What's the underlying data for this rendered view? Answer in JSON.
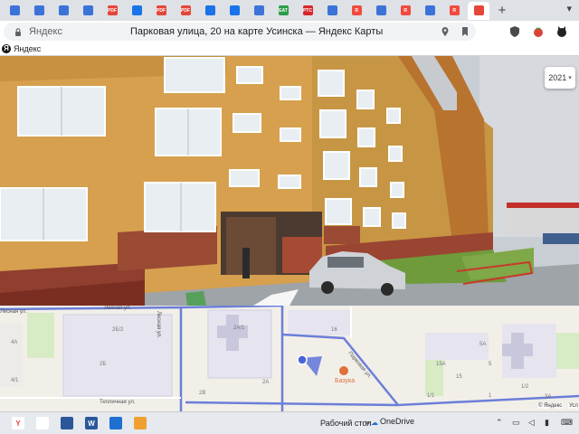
{
  "tabs": {
    "items": [
      {
        "icon": "bookmark-icon",
        "color": "#3b73d9",
        "text": ""
      },
      {
        "icon": "bookmark-icon",
        "color": "#3b73d9",
        "text": ""
      },
      {
        "icon": "bookmark-icon",
        "color": "#3b73d9",
        "text": ""
      },
      {
        "icon": "bookmark-icon",
        "color": "#3b73d9",
        "text": ""
      },
      {
        "icon": "pdf-icon",
        "color": "#e5463a",
        "text": "PDF"
      },
      {
        "icon": "mail-icon",
        "color": "#1a73e8",
        "text": ""
      },
      {
        "icon": "pdf-icon",
        "color": "#e5463a",
        "text": "PDF"
      },
      {
        "icon": "pdf-icon",
        "color": "#e5463a",
        "text": "PDF"
      },
      {
        "icon": "mail-icon",
        "color": "#1a73e8",
        "text": ""
      },
      {
        "icon": "mail-icon",
        "color": "#1a73e8",
        "text": ""
      },
      {
        "icon": "doc-icon",
        "color": "#3b73d9",
        "text": ""
      },
      {
        "icon": "eat-icon",
        "color": "#2d9d4a",
        "text": "EAT"
      },
      {
        "icon": "rtc-icon",
        "color": "#d8262b",
        "text": "РТС"
      },
      {
        "icon": "doc-icon",
        "color": "#3b73d9",
        "text": ""
      },
      {
        "icon": "yandex-icon",
        "color": "#f14b3f",
        "text": "Я"
      },
      {
        "icon": "doc-icon",
        "color": "#3b73d9",
        "text": ""
      },
      {
        "icon": "yandex-icon",
        "color": "#f14b3f",
        "text": "Я"
      },
      {
        "icon": "wifi-icon",
        "color": "#3b73d9",
        "text": ""
      },
      {
        "icon": "yandex-icon",
        "color": "#f14b3f",
        "text": "Я"
      },
      {
        "icon": "map-pin-icon",
        "color": "#e5463a",
        "text": ""
      }
    ],
    "active_index": 19,
    "new_tab": "+"
  },
  "toolbar": {
    "site_name": "Яндекс",
    "page_title": "Парковая улица, 20 на карте Усинска — Яндекс Карты"
  },
  "bookmarks": {
    "label": "Яндекс",
    "logo": "Я"
  },
  "panorama": {
    "year": "2021"
  },
  "map": {
    "streets": {
      "lesnaya_left": "Лесная ул.",
      "lesnaya_top": "Лесная ул.",
      "lesnaya_vertical": "Лесная ул.",
      "parkovaya": "Парковая ул.",
      "teplichnaya": "Тепличная ул."
    },
    "houses": [
      "4А",
      "4/1",
      "2Б/2",
      "2Б",
      "2А/1",
      "2В",
      "2А",
      "16",
      "15А",
      "15",
      "1/1",
      "1",
      "1/2",
      "3А",
      "5А",
      "5"
    ],
    "poi": "Базука",
    "attribution": "© Яндекс",
    "conditions": "Усл"
  },
  "taskbar": {
    "desktop_label": "Рабочий стол",
    "onedrive_label": "OneDrive",
    "apps": [
      {
        "name": "yandex-browser-taskbar-icon",
        "color": "#ffffff",
        "text": "Y",
        "fg": "#e5463a"
      },
      {
        "name": "chrome-taskbar-icon",
        "color": "#ffffff",
        "text": "",
        "fg": "#000"
      },
      {
        "name": "calculator-taskbar-icon",
        "color": "#2b579a",
        "text": "",
        "fg": "#fff"
      },
      {
        "name": "word-taskbar-icon",
        "color": "#2b579a",
        "text": "W",
        "fg": "#fff"
      },
      {
        "name": "photos-taskbar-icon",
        "color": "#1e6fd0",
        "text": "",
        "fg": "#fff"
      },
      {
        "name": "app-taskbar-icon",
        "color": "#f0a030",
        "text": "",
        "fg": "#fff"
      }
    ]
  }
}
